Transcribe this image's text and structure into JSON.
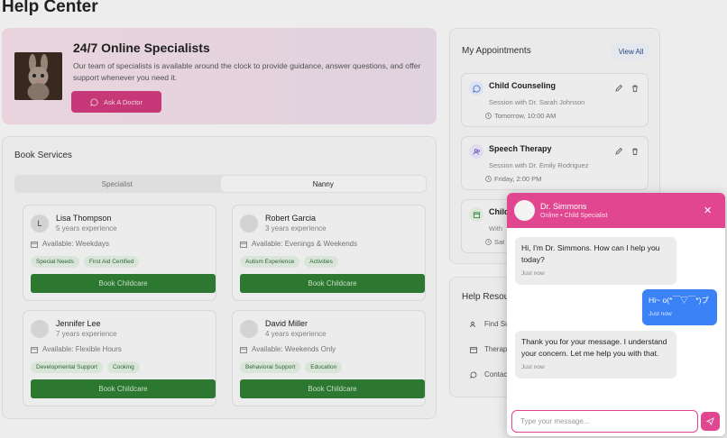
{
  "page": {
    "title": "Help Center"
  },
  "hero": {
    "title": "24/7 Online Specialists",
    "description": "Our team of specialists is available around the clock to provide guidance, answer questions, and offer support whenever you need it.",
    "button": "Ask A Doctor"
  },
  "book": {
    "title": "Book Services",
    "tabs": [
      "Specialist",
      "Nanny"
    ],
    "active_tab": "Nanny",
    "nannies": [
      {
        "initial": "L",
        "name": "Lisa Thompson",
        "experience": "5 years experience",
        "availability": "Available: Weekdays",
        "tags": [
          "Special Needs",
          "First Aid Certified"
        ],
        "button": "Book Childcare"
      },
      {
        "initial": "",
        "name": "Robert Garcia",
        "experience": "3 years experience",
        "availability": "Available: Evenings & Weekends",
        "tags": [
          "Autism Experience",
          "Activities"
        ],
        "button": "Book Childcare"
      },
      {
        "initial": "",
        "name": "Jennifer Lee",
        "experience": "7 years experience",
        "availability": "Available: Flexible Hours",
        "tags": [
          "Developmental Support",
          "Cooking"
        ],
        "button": "Book Childcare"
      },
      {
        "initial": "",
        "name": "David Miller",
        "experience": "4 years experience",
        "availability": "Available: Weekends Only",
        "tags": [
          "Behavioral Support",
          "Education"
        ],
        "button": "Book Childcare"
      }
    ]
  },
  "appointments": {
    "title": "My Appointments",
    "view_all": "View All",
    "items": [
      {
        "title": "Child Counseling",
        "subtitle": "Session with Dr. Sarah Johnson",
        "time": "Tomorrow, 10:00 AM",
        "icon": "chat-icon"
      },
      {
        "title": "Speech Therapy",
        "subtitle": "Session with Dr. Emily Rodriguez",
        "time": "Friday, 2:00 PM",
        "icon": "users-icon"
      },
      {
        "title": "Child",
        "subtitle": "With",
        "time": "Sat",
        "icon": "calendar-icon"
      }
    ]
  },
  "help": {
    "title": "Help Resou",
    "items": [
      "Find Su",
      "Therap",
      "Contac"
    ]
  },
  "chat": {
    "name": "Dr. Simmons",
    "status": "Online • Child Specialist",
    "messages": [
      {
        "from": "bot",
        "text": "Hi, I'm Dr. Simmons. How can I help you today?",
        "time": "Just now"
      },
      {
        "from": "user",
        "text": "Hi~ o(*￣▽￣*)ブ",
        "time": "Just now"
      },
      {
        "from": "bot",
        "text": "Thank you for your message. I understand your concern. Let me help you with that.",
        "time": "Just now"
      }
    ],
    "input_placeholder": "Type your message..."
  },
  "colors": {
    "accent": "#e14690",
    "book_button": "#2e7d34",
    "user_bubble": "#3b82f6",
    "ask_button": "#cf3b7c"
  }
}
